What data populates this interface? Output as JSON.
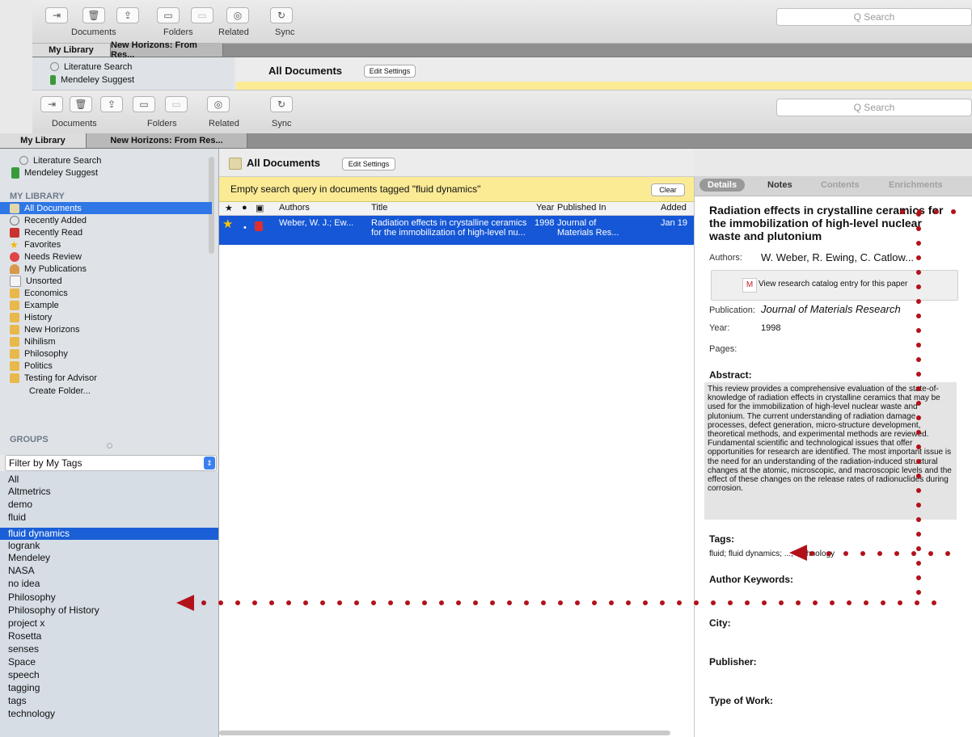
{
  "toolbar": {
    "documents_label": "Documents",
    "folders_label": "Folders",
    "related_label": "Related",
    "sync_label": "Sync",
    "search_placeholder": "Q Search"
  },
  "tabs": {
    "library": "My Library",
    "second": "New Horizons: From Res..."
  },
  "sidebar": {
    "top_items": [
      "Literature Search",
      "Mendeley Suggest"
    ],
    "my_library_header": "MY LIBRARY",
    "library_items": [
      {
        "label": "All Documents",
        "icon": "documents-icon",
        "selected": true
      },
      {
        "label": "Recently Added",
        "icon": "clock-icon"
      },
      {
        "label": "Recently Read",
        "icon": "book-icon"
      },
      {
        "label": "Favorites",
        "icon": "star-icon"
      },
      {
        "label": "Needs Review",
        "icon": "alert-icon"
      },
      {
        "label": "My Publications",
        "icon": "person-icon"
      },
      {
        "label": "Unsorted",
        "icon": "tray-icon"
      },
      {
        "label": "Economics",
        "icon": "folder-icon"
      },
      {
        "label": "Example",
        "icon": "folder-icon"
      },
      {
        "label": "History",
        "icon": "folder-icon"
      },
      {
        "label": "New Horizons",
        "icon": "folder-icon"
      },
      {
        "label": "Nihilism",
        "icon": "folder-icon"
      },
      {
        "label": "Philosophy",
        "icon": "folder-icon"
      },
      {
        "label": "Politics",
        "icon": "folder-icon"
      },
      {
        "label": "Testing for Advisor",
        "icon": "folder-icon"
      }
    ],
    "create_folder": "Create Folder...",
    "groups_header": "GROUPS"
  },
  "tags_filter": {
    "label": "Filter by My Tags",
    "tags": [
      "All",
      "Altmetrics",
      "demo",
      "fluid",
      "fluid dynamics",
      "logrank",
      "Mendeley",
      "NASA",
      "no idea",
      "Philosophy",
      "Philosophy of History",
      "project x",
      "Rosetta",
      "senses",
      "Space",
      "speech",
      "tagging",
      "tags",
      "technology"
    ],
    "selected": "fluid dynamics"
  },
  "center": {
    "title": "All Documents",
    "edit_settings": "Edit Settings",
    "notice": "Empty search query in documents tagged \"fluid dynamics\"",
    "clear": "Clear",
    "columns": {
      "authors": "Authors",
      "title": "Title",
      "year": "Year",
      "published": "Published In",
      "added": "Added"
    },
    "rows": [
      {
        "authors": "Weber, W. J.; Ew...",
        "title_line1": "Radiation effects in crystalline ceramics",
        "title_line2": "for the immobilization of high-level nu...",
        "year": "1998",
        "published_line1": "Journal of",
        "published_line2": "Materials Res...",
        "added": "Jan 19"
      }
    ],
    "bg_title": "All Documents",
    "bg_notice": "Empty search query in documents tagged \"fluid dynamics\""
  },
  "details": {
    "tabs": {
      "details": "Details",
      "notes": "Notes",
      "contents": "Contents",
      "enrichments": "Enrichments"
    },
    "title": "Radiation effects in crystalline ceramics for the immobilization of high-level nuclear waste and plutonium",
    "authors_label": "Authors:",
    "authors": "W. Weber, R. Ewing, C. Catlow...",
    "catalog_link": "View research catalog entry for this paper",
    "publication_label": "Publication:",
    "publication": "Journal of Materials Research",
    "year_label": "Year:",
    "year": "1998",
    "pages_label": "Pages:",
    "abstract_label": "Abstract:",
    "abstract": "This review provides a comprehensive evaluation of the state-of-knowledge of radiation effects in crystalline ceramics that may be used for the immobilization of high-level nuclear waste and plutonium. The current understanding of radiation damage processes, defect generation, micro-structure development, theoretical methods, and experimental methods are reviewed. Fundamental scientific and technological issues that offer opportunities for research are identified. The most important issue is the need for an understanding of the radiation-induced structural changes at the atomic, microscopic, and macroscopic levels and the effect of these changes on the release rates of radionuclides during corrosion.",
    "tags_label": "Tags:",
    "tags_value": "fluid; fluid dynamics; ...; technology",
    "author_keywords_label": "Author Keywords:",
    "city_label": "City:",
    "publisher_label": "Publisher:",
    "type_label": "Type of Work:"
  },
  "colors": {
    "selection": "#1557d6",
    "notice": "#fbeb95",
    "annotation": "#b3111a"
  }
}
